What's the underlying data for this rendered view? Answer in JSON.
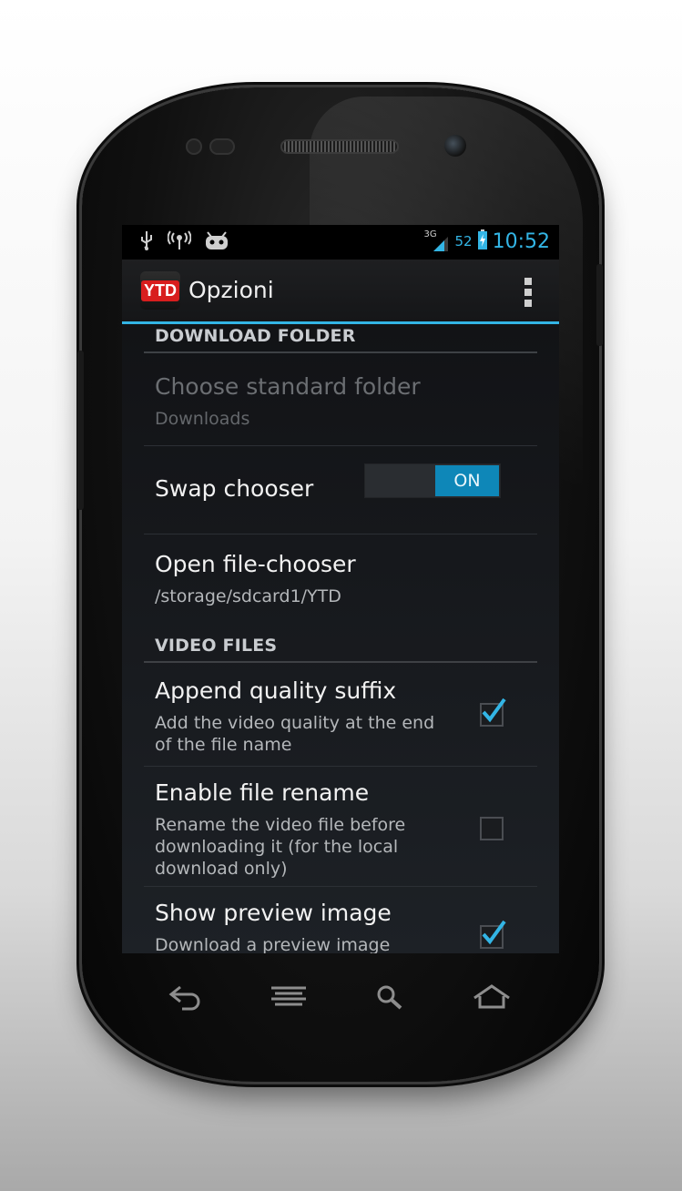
{
  "status_bar": {
    "left_icons": [
      "usb-icon",
      "wireless-icon",
      "android-debug-icon"
    ],
    "network": "3G",
    "battery_percent": "52",
    "time": "10:52"
  },
  "action_bar": {
    "app_icon_text": "YTD",
    "title": "Opzioni",
    "overflow_icon": "overflow-menu-icon"
  },
  "sections": {
    "download_folder": {
      "header": "DOWNLOAD FOLDER",
      "choose_standard": {
        "title": "Choose standard folder",
        "summary": "Downloads",
        "enabled": false
      },
      "swap_chooser": {
        "title": "Swap chooser",
        "toggle_label": "ON",
        "value": true
      },
      "open_file_chooser": {
        "title": "Open file-chooser",
        "summary": "/storage/sdcard1/YTD"
      }
    },
    "video_files": {
      "header": "VIDEO FILES",
      "items": [
        {
          "title": "Append quality suffix",
          "summary": "Add the video quality at the end of the file name",
          "checked": true
        },
        {
          "title": "Enable file rename",
          "summary": "Rename the video file before downloading it (for the local download only)",
          "checked": false
        },
        {
          "title": "Show preview image",
          "summary": "Download a preview image",
          "checked": true
        }
      ]
    }
  },
  "nav_bar": [
    "back-icon",
    "menu-icon",
    "search-icon",
    "home-icon"
  ],
  "colors": {
    "accent": "#33b5e5",
    "toggle_on": "#0e87b8",
    "brand_red": "#d81e1e"
  }
}
